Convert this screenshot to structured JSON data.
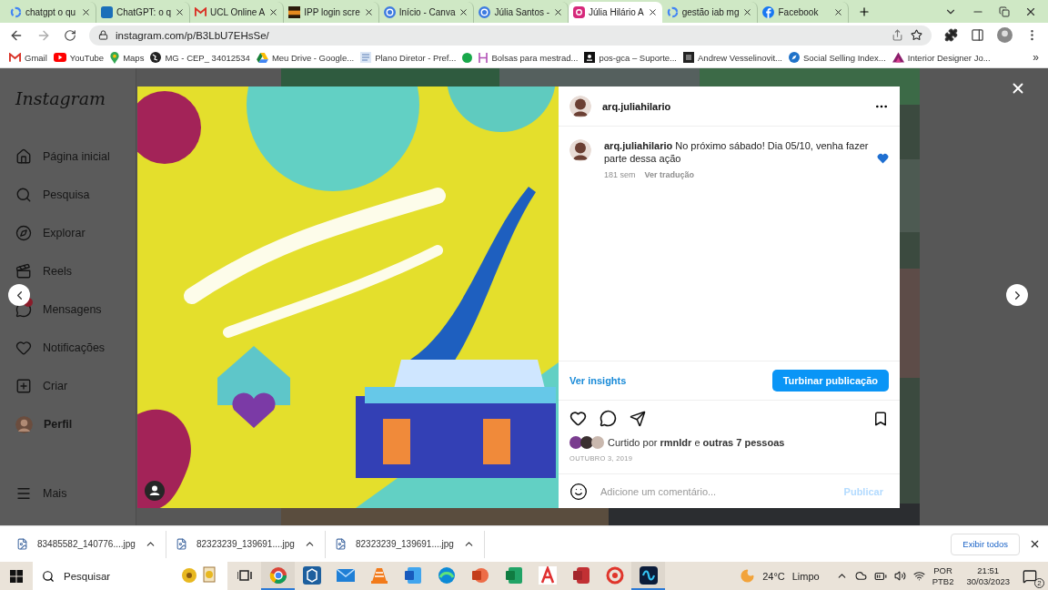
{
  "browser": {
    "tabs": [
      {
        "title": "chatgpt o qu",
        "kind": "ring",
        "selected": false
      },
      {
        "title": "ChatGPT: o q",
        "kind": "square",
        "selected": false
      },
      {
        "title": "UCL Online A",
        "kind": "mail",
        "selected": false
      },
      {
        "title": "IPP login scre",
        "kind": "tile",
        "selected": false
      },
      {
        "title": "Início - Canva",
        "kind": "circle",
        "selected": false
      },
      {
        "title": "Júlia Santos -",
        "kind": "circle",
        "selected": false
      },
      {
        "title": "Júlia Hilário A",
        "kind": "camera",
        "selected": true
      },
      {
        "title": "gestão iab mg",
        "kind": "ring",
        "selected": false
      },
      {
        "title": "Facebook",
        "kind": "round",
        "selected": false
      }
    ],
    "address": "instagram.com/p/B3LbU7EHsSe/",
    "bookmarks": [
      {
        "label": "Gmail",
        "kind": "mail"
      },
      {
        "label": "YouTube",
        "kind": "play"
      },
      {
        "label": "Maps",
        "kind": "pin"
      },
      {
        "label": "MG - CEP_ 34012534",
        "kind": "globe"
      },
      {
        "label": "Meu Drive - Google...",
        "kind": "drive"
      },
      {
        "label": "Plano Diretor - Pref...",
        "kind": "doc"
      },
      {
        "kind": "dot"
      },
      {
        "label": "Bolsas para mestrad...",
        "kind": "letter"
      },
      {
        "label": "pos-gca – Suporte...",
        "kind": "badge"
      },
      {
        "label": "Andrew Vesselinovit...",
        "kind": "block"
      },
      {
        "label": "Social Selling Index...",
        "kind": "compass"
      },
      {
        "label": "Interior Designer Jo...",
        "kind": "logo"
      }
    ],
    "more": "»"
  },
  "instagram": {
    "logo": "Instagram",
    "nav": [
      {
        "label": "Página inicial",
        "kind": "home",
        "selected": false,
        "badge": false
      },
      {
        "label": "Pesquisa",
        "kind": "search",
        "selected": false,
        "badge": false
      },
      {
        "label": "Explorar",
        "kind": "explore",
        "selected": false,
        "badge": false
      },
      {
        "label": "Reels",
        "kind": "reels",
        "selected": false,
        "badge": false
      },
      {
        "label": "Mensagens",
        "kind": "messages",
        "selected": false,
        "badge": true
      },
      {
        "label": "Notificações",
        "kind": "heart",
        "selected": false,
        "badge": false
      },
      {
        "label": "Criar",
        "kind": "create",
        "selected": false,
        "badge": false
      },
      {
        "label": "Perfil",
        "kind": "profile",
        "selected": true,
        "badge": false
      },
      {
        "label": "Mais",
        "kind": "menu",
        "selected": false,
        "badge": false
      }
    ],
    "post": {
      "username": "arq.juliahilario",
      "caption": "**arq.juliahilario** No próximo sábado! Dia 05/10, venha fazer parte dessa ação",
      "age": "181 sem",
      "translate": "Ver tradução",
      "insights": "Ver insights",
      "boost": "Turbinar publicação",
      "likes": "Curtido por **rmnldr** e **outras 7 pessoas**",
      "date": "OUTUBRO 3, 2019",
      "comment_placeholder": "Adicione um comentário...",
      "publish": {
        "label": "Publicar",
        "disabled": true
      }
    }
  },
  "downloads": {
    "files": [
      "83485582_140776....jpg",
      "82323239_139691....jpg",
      "82323239_139691....jpg"
    ],
    "show_all": "Exibir todos"
  },
  "taskbar": {
    "search_placeholder": "Pesquisar",
    "apps": [
      {
        "kind": "browser",
        "active": true
      },
      {
        "kind": "cube",
        "active": false
      },
      {
        "kind": "mail",
        "active": false
      },
      {
        "kind": "cone",
        "active": false
      },
      {
        "kind": "document",
        "active": false
      },
      {
        "kind": "globe",
        "active": false
      },
      {
        "kind": "slides",
        "active": false
      },
      {
        "kind": "sheet",
        "active": false
      },
      {
        "kind": "pdf",
        "active": false
      },
      {
        "kind": "database",
        "active": false
      },
      {
        "kind": "disc",
        "active": false
      },
      {
        "kind": "video",
        "active": true
      }
    ],
    "weather": {
      "temp": "24°C",
      "condition": "Limpo"
    },
    "language": "POR",
    "layout": "PTB2",
    "time": "21:51",
    "date": "30/03/2023",
    "notifications": "2"
  }
}
